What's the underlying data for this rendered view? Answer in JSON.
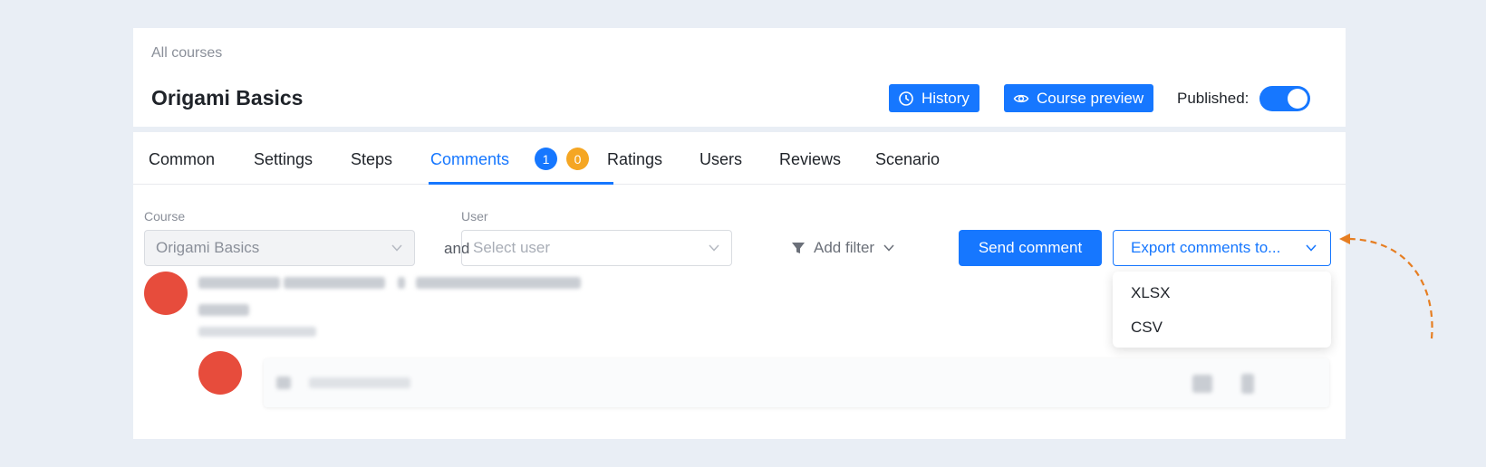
{
  "header": {
    "breadcrumb": "All courses",
    "title": "Origami Basics",
    "history_label": "History",
    "preview_label": "Course preview",
    "published_label": "Published:",
    "published_on": true
  },
  "tabs": {
    "items": [
      "Common",
      "Settings",
      "Steps",
      "Comments",
      "Ratings",
      "Users",
      "Reviews",
      "Scenario"
    ],
    "active": "Comments",
    "badge_blue": "1",
    "badge_orange": "0"
  },
  "filters": {
    "course_label": "Course",
    "course_value": "Origami Basics",
    "and_label": "and",
    "user_label": "User",
    "user_placeholder": "Select user",
    "add_filter_label": "Add filter"
  },
  "actions": {
    "send_comment_label": "Send comment",
    "export_label": "Export comments to...",
    "export_options": [
      "XLSX",
      "CSV"
    ]
  },
  "colors": {
    "accent": "#1677ff",
    "badge_orange": "#f5a623",
    "avatar": "#e74c3c",
    "annotation_arrow": "#e67e22"
  }
}
